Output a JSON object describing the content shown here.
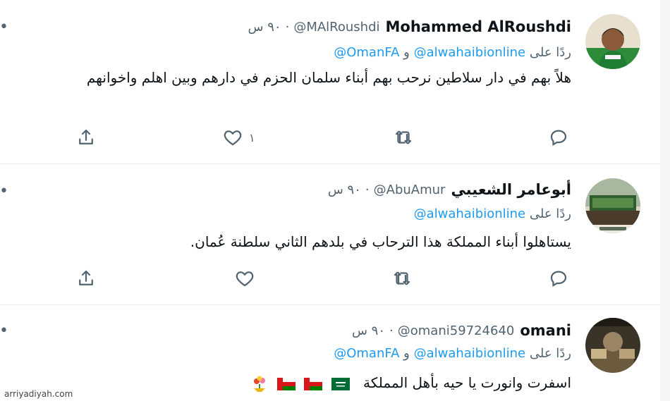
{
  "colors": {
    "link": "#1d9bf0",
    "muted": "#536471",
    "text": "#0f1419",
    "divider": "#e6ecf0"
  },
  "tweets": [
    {
      "display_name": "Mohammed AlRoushdi",
      "handle": "@MAlRoushdi",
      "time": "٩٠ س",
      "reply_prefix": "ردًا على",
      "mention_1": "@alwahaibionline",
      "reply_joiner": "و",
      "mention_2": "@OmanFA",
      "body": "هلاً بهم في دار سلاطين نرحب بهم أبناء سلمان الحزم في دارهم وبين اهلم واخوانهم",
      "like_count": "١",
      "icons": [
        "reply-icon",
        "retweet-icon",
        "like-icon",
        "share-icon"
      ]
    },
    {
      "display_name": "أبوعامر الشعيبي",
      "handle": "@AbuAmur",
      "time": "٩٠ س",
      "reply_prefix": "ردًا على",
      "mention_1": "@alwahaibionline",
      "body": "يستاهلوا أبناء المملكة هذا الترحاب في بلدهم الثاني سلطنة عُمان.",
      "like_count": "",
      "icons": [
        "reply-icon",
        "retweet-icon",
        "like-icon",
        "share-icon"
      ]
    },
    {
      "display_name": "omani",
      "handle": "@omani59724640",
      "time": "٩٠ س",
      "reply_prefix": "ردًا على",
      "mention_1": "@alwahaibionline",
      "reply_joiner": "و",
      "mention_2": "@OmanFA",
      "body": "اسفرت وانورت يا حيه بأهل المملكة",
      "emojis": [
        "saudi-flag",
        "oman-flag",
        "oman-flag",
        "flowers"
      ]
    }
  ],
  "watermark": "arriyadiyah.com"
}
